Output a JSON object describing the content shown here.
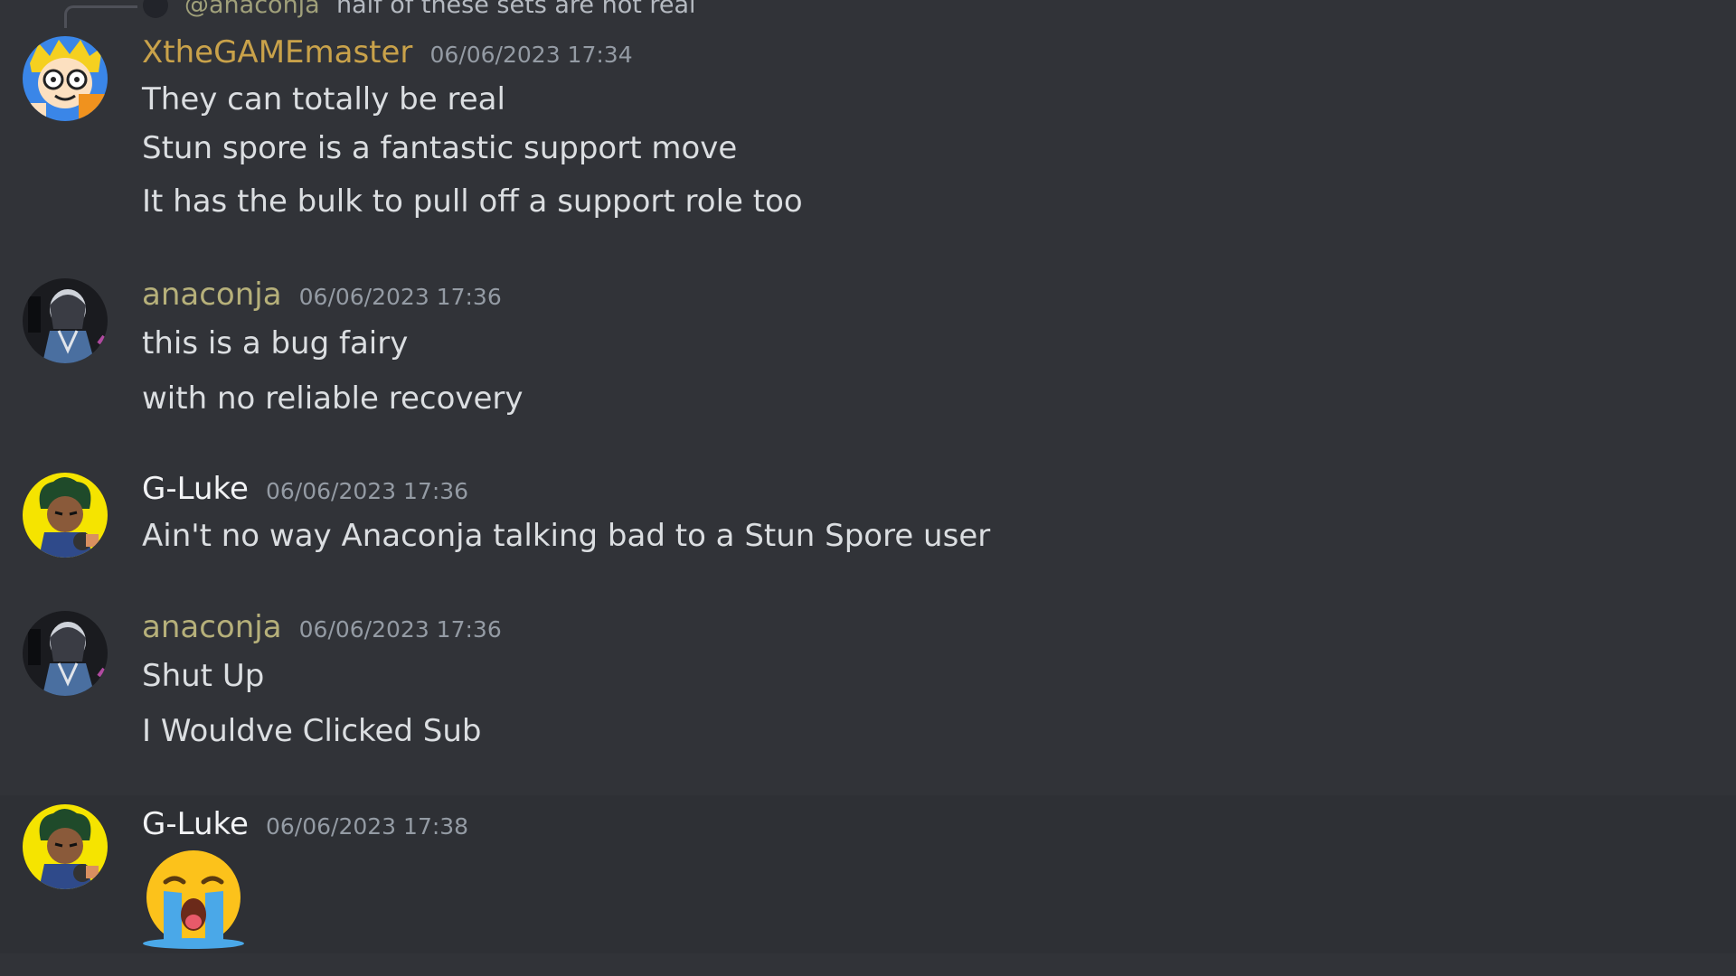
{
  "reply": {
    "mention": "@anaconja",
    "text": "half of these sets are not real"
  },
  "colors": {
    "background": "#313338",
    "xthegamemaster": "#c9a24a",
    "anaconja": "#b6b07a",
    "gluke": "#f2f3f5",
    "timestamp": "#949ba4"
  },
  "messages": [
    {
      "username": "XtheGAMEmaster",
      "timestamp": "06/06/2023 17:34",
      "lines": [
        "They can totally be real",
        "Stun spore is a fantastic support move",
        "It has the bulk to pull off a support role too"
      ]
    },
    {
      "username": "anaconja",
      "timestamp": "06/06/2023 17:36",
      "lines": [
        "this is a bug fairy",
        "with no reliable recovery"
      ]
    },
    {
      "username": "G-Luke",
      "timestamp": "06/06/2023 17:36",
      "lines": [
        "Ain't no way Anaconja talking bad to a Stun Spore user"
      ]
    },
    {
      "username": "anaconja",
      "timestamp": "06/06/2023 17:36",
      "lines": [
        "Shut Up",
        "I Wouldve Clicked Sub"
      ]
    },
    {
      "username": "G-Luke",
      "timestamp": "06/06/2023 17:38",
      "emoji": "loudly-crying-face-emoji"
    }
  ]
}
